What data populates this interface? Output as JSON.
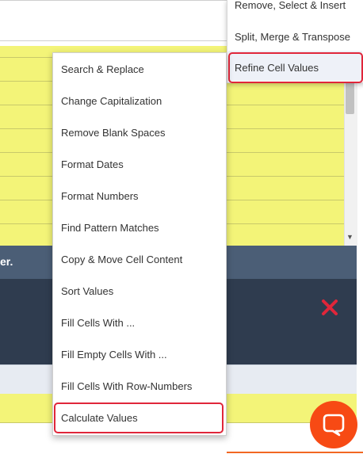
{
  "background": {
    "grid_color": "#f3f478",
    "band_text": "er."
  },
  "submenu": {
    "items": [
      {
        "label": "Remove, Select & Insert"
      },
      {
        "label": "Split, Merge & Transpose"
      },
      {
        "label": "Refine Cell Values",
        "active": true
      }
    ]
  },
  "menu": {
    "items": [
      {
        "label": "Search & Replace"
      },
      {
        "label": "Change Capitalization"
      },
      {
        "label": "Remove Blank Spaces"
      },
      {
        "label": "Format Dates"
      },
      {
        "label": "Format Numbers"
      },
      {
        "label": "Find Pattern Matches"
      },
      {
        "label": "Copy & Move Cell Content"
      },
      {
        "label": "Sort Values"
      },
      {
        "label": "Fill Cells With ..."
      },
      {
        "label": "Fill Empty Cells With ..."
      },
      {
        "label": "Fill Cells With Row-Numbers"
      },
      {
        "label": "Calculate Values",
        "highlighted": true
      }
    ]
  },
  "colors": {
    "highlight": "#e0263a",
    "accent": "#f74a14",
    "dark_band": "#2f3c4f"
  },
  "icons": {
    "close": "close-x-icon",
    "chat": "chat-bubble-icon"
  }
}
